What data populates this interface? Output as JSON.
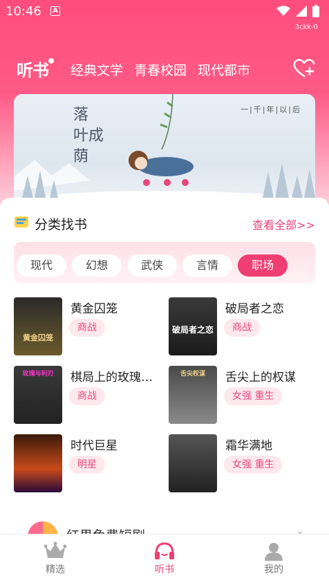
{
  "status_bar": {
    "time": "10:46",
    "app_indicator": "A",
    "build": "3ckk-0"
  },
  "nav": {
    "logo": "听书",
    "tabs": [
      "经典文学",
      "青春校园",
      "现代都市"
    ]
  },
  "banner": {
    "title_chars": [
      "落",
      "叶成",
      "荫"
    ],
    "subtitle": "一|千|年|以|后"
  },
  "category": {
    "title": "分类找书",
    "view_all": "查看全部>>",
    "genres": [
      "现代",
      "幻想",
      "武侠",
      "言情",
      "职场"
    ],
    "active_genre": "职场"
  },
  "books": [
    {
      "title": "黄金囚笼",
      "tag": "商战",
      "cover_text": "黄金囚笼"
    },
    {
      "title": "破局者之恋",
      "tag": "商战",
      "cover_text": "破局者之恋"
    },
    {
      "title": "棋局上的玫瑰…",
      "tag": "商战",
      "cover_text": "玫瑰与利刃"
    },
    {
      "title": "舌尖上的权谋",
      "tag": "女强 重生",
      "cover_text": "舌尖权谋"
    },
    {
      "title": "时代巨星",
      "tag": "明星",
      "cover_text": ""
    },
    {
      "title": "霜华满地",
      "tag": "女强 重生",
      "cover_text": ""
    }
  ],
  "next_section": {
    "title": "红果免费短剧"
  },
  "bottom_nav": [
    {
      "label": "精选",
      "icon": "crown-icon"
    },
    {
      "label": "听书",
      "icon": "headphones-icon"
    },
    {
      "label": "我的",
      "icon": "user-icon"
    }
  ],
  "colors": {
    "accent": "#ef3f72",
    "tag_bg": "#fde8ee",
    "tag_text": "#e64d7c"
  }
}
